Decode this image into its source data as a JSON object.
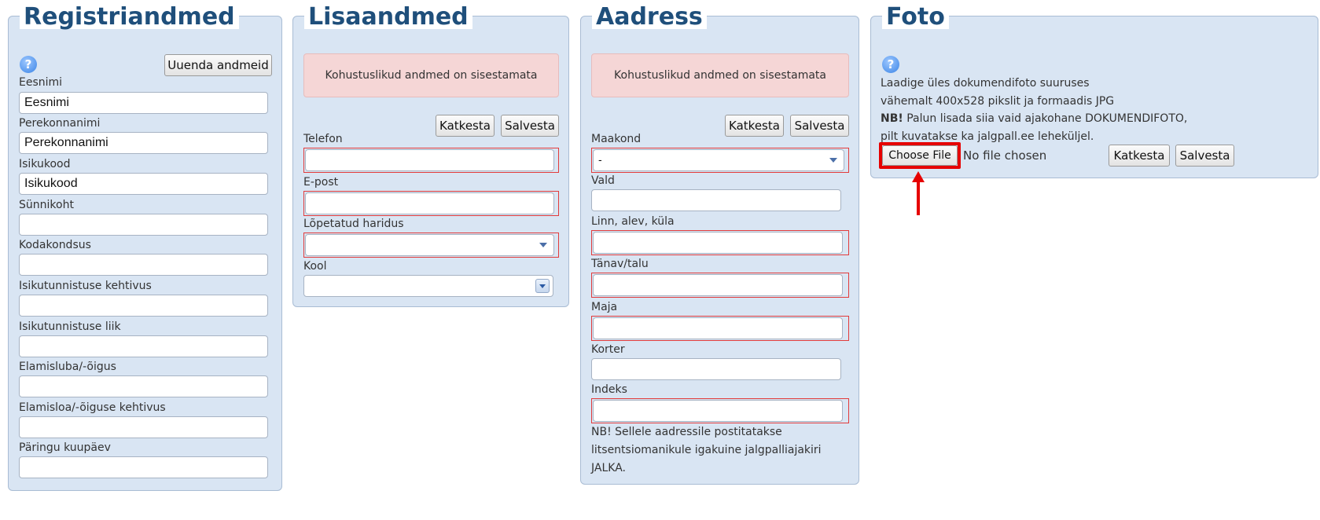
{
  "registriandmed": {
    "title": "Registriandmed",
    "update_button": "Uuenda andmeid",
    "fields": [
      {
        "label": "Eesnimi",
        "value": "Eesnimi"
      },
      {
        "label": "Perekonnanimi",
        "value": "Perekonnanimi"
      },
      {
        "label": "Isikukood",
        "value": "Isikukood"
      },
      {
        "label": "Sünnikoht",
        "value": ""
      },
      {
        "label": "Kodakondsus",
        "value": ""
      },
      {
        "label": "Isikutunnistuse kehtivus",
        "value": ""
      },
      {
        "label": "Isikutunnistuse liik",
        "value": ""
      },
      {
        "label": "Elamisluba/-õigus",
        "value": ""
      },
      {
        "label": "Elamisloa/-õiguse kehtivus",
        "value": ""
      },
      {
        "label": "Päringu kuupäev",
        "value": ""
      }
    ]
  },
  "lisaandmed": {
    "title": "Lisaandmed",
    "alert": "Kohustuslikud andmed on sisestamata",
    "cancel_button": "Katkesta",
    "save_button": "Salvesta",
    "fields": [
      {
        "label": "Telefon",
        "value": ""
      },
      {
        "label": "E-post",
        "value": ""
      },
      {
        "label": "Lõpetatud haridus",
        "value": ""
      },
      {
        "label": "Kool",
        "value": ""
      }
    ]
  },
  "aadress": {
    "title": "Aadress",
    "alert": "Kohustuslikud andmed on sisestamata",
    "cancel_button": "Katkesta",
    "save_button": "Salvesta",
    "fields": [
      {
        "label": "Maakond",
        "value": "-"
      },
      {
        "label": "Vald",
        "value": ""
      },
      {
        "label": "Linn, alev, küla",
        "value": ""
      },
      {
        "label": "Tänav/talu",
        "value": ""
      },
      {
        "label": "Maja",
        "value": ""
      },
      {
        "label": "Korter",
        "value": ""
      },
      {
        "label": "Indeks",
        "value": ""
      }
    ],
    "note_line1": "NB! Sellele aadressile postitatakse",
    "note_line2": "litsentsiomanikule igakuine jalgpalliajakiri JALKA."
  },
  "foto": {
    "title": "Foto",
    "info_line1": "Laadige üles dokumendifoto suuruses",
    "info_line2": "vähemalt 400x528 pikslit ja formaadis JPG",
    "info_nb": "NB!",
    "info_line3": " Palun lisada siia vaid ajakohane DOKUMENDIFOTO,",
    "info_line4": "pilt kuvatakse ka jalgpall.ee leheküljel.",
    "choose_file_button": "Choose File",
    "no_file_text": "No file chosen",
    "cancel_button": "Katkesta",
    "save_button": "Salvesta"
  },
  "help_icon_glyph": "?",
  "colors": {
    "highlight": "#e60000",
    "required_border": "#e23b3b",
    "panel_bg": "#d9e5f3",
    "title": "#1f4f7b"
  }
}
